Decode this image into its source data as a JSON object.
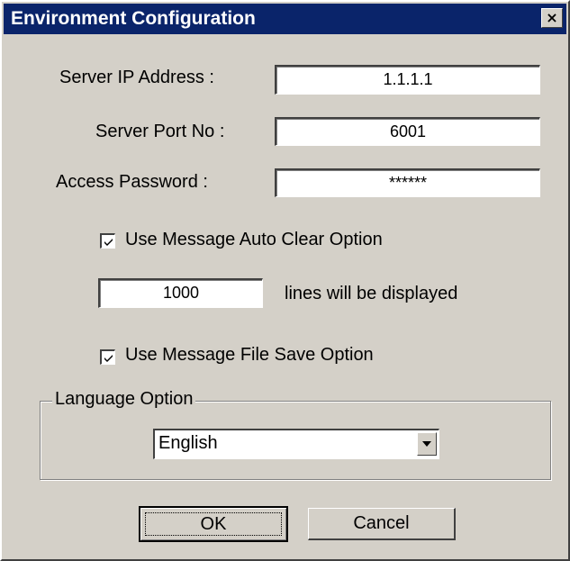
{
  "window": {
    "title": "Environment Configuration",
    "close_glyph": "×"
  },
  "form": {
    "server_ip": {
      "label": "Server IP Address :",
      "value": "1.1.1.1"
    },
    "server_port": {
      "label": "Server Port No :",
      "value": "6001"
    },
    "access_password": {
      "label": "Access Password :",
      "value": "******"
    },
    "auto_clear": {
      "label": "Use Message Auto Clear Option",
      "checked": true
    },
    "lines": {
      "value": "1000",
      "suffix": "lines will be displayed"
    },
    "file_save": {
      "label": "Use Message File Save Option",
      "checked": true
    }
  },
  "language": {
    "group_label": "Language Option",
    "selected": "English"
  },
  "buttons": {
    "ok": "OK",
    "cancel": "Cancel"
  },
  "icons": {
    "close": "close-icon",
    "check": "checkmark-icon",
    "dropdown": "chevron-down-icon"
  },
  "colors": {
    "titlebar": "#0a246a",
    "dialog_bg": "#d4d0c8"
  }
}
